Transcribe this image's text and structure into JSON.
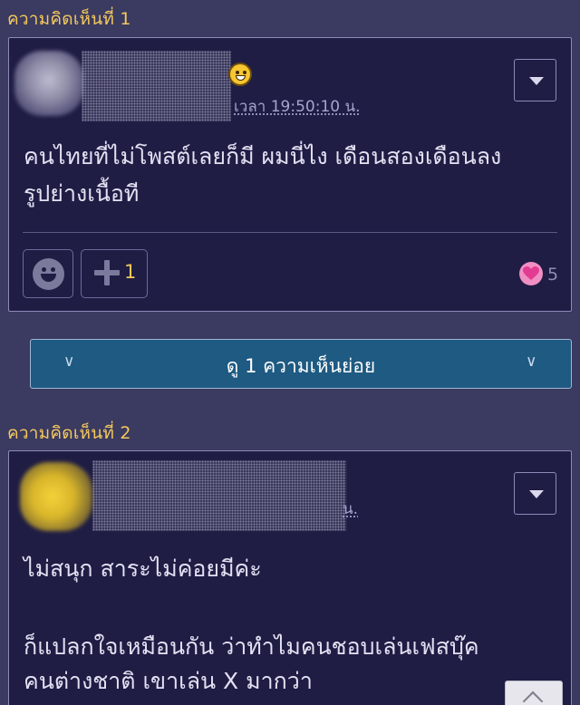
{
  "comments": [
    {
      "header": "ความคิดเห็นที่ 1",
      "time": "เวลา 19:50:10 น.",
      "body": [
        "คนไทยที่ไม่โพสต์เลยก็มี ผมนี่ไง เดือนสองเดือนลง",
        "รูปย่างเนื้อที"
      ],
      "plus_count": "1",
      "like_count": "5"
    },
    {
      "header": "ความคิดเห็นที่ 2",
      "time_suffix": "น.",
      "body": [
        "ไม่สนุก สาระไม่ค่อยมีค่ะ",
        "ก็แปลกใจเหมือนกัน ว่าทำไมคนชอบเล่นเฟสบุ๊ค",
        "คนต่างชาติ เขาเล่น X มากว่า"
      ]
    }
  ],
  "subcomments": {
    "label": "ดู 1 ความเห็นย่อย",
    "chevron": "∨"
  },
  "icons": {
    "menu": "chevron-down-icon",
    "emoji": "laughing-emoji-icon",
    "smile": "smile-reaction-icon",
    "plus": "plus-icon",
    "heart": "heart-icon",
    "scroll": "chevron-up-icon"
  },
  "colors": {
    "background": "#3b3a60",
    "card": "#1f1d44",
    "header": "#f4c95d",
    "expand_bar": "#1e5a82",
    "heart": "#f08fc4"
  }
}
